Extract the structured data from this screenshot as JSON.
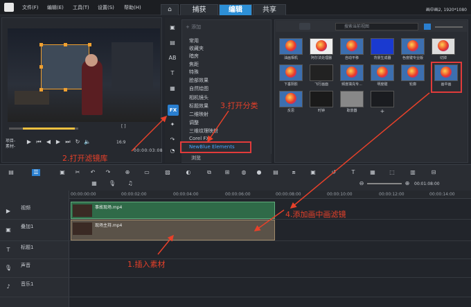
{
  "menus": [
    "文件(F)",
    "编辑(E)",
    "工具(T)",
    "设置(S)",
    "帮助(H)"
  ],
  "modes": [
    "捕获",
    "编辑",
    "共享"
  ],
  "project_info": "画中画2, 1920*1080",
  "preview": {
    "labels": [
      "项目-",
      "素材-"
    ],
    "timecode": "00:00:03:08",
    "zoom": "16:9"
  },
  "category_panel": {
    "add_label": "添加",
    "categories": [
      "常用",
      "收藏夹",
      "暗房",
      "焦距",
      "特殊",
      "脸部效果",
      "自然绘图",
      "相机镜头",
      "标题效果",
      "二维映射",
      "调整",
      "三维纹理映射",
      "Corel FX",
      "NewBlue Elements"
    ],
    "browse_label": "浏览"
  },
  "library": {
    "search_placeholder": "搜索当前视图",
    "effects": [
      "油画相机",
      "阿尔法处理器",
      "自动平移",
      "背景生成器",
      "色度键专业版",
      "切掉",
      "下垂阴影",
      "飞行画面",
      "频度填充专...",
      "明度键",
      "轮廓",
      "画中画",
      "反思",
      "时钟",
      "取景器"
    ]
  },
  "timeline": {
    "ruler": [
      "00:00:00:00",
      "00:00:02:00",
      "00:00:04:00",
      "00:00:06:00",
      "00:00:08:00",
      "00:00:10:00",
      "00:00:12:00",
      "00:00:14:00"
    ],
    "timecode": "00:01:08:00",
    "tracks": [
      "视频",
      "叠加1",
      "标题1",
      "声音",
      "音乐1"
    ],
    "clips": [
      {
        "track": "视频",
        "label": "事故现场.mp4"
      },
      {
        "track": "叠加1",
        "label": "现场主持.mp4"
      }
    ]
  },
  "annotations": [
    "1.插入素材",
    "2.打开滤镜库",
    "3.打开分类",
    "4.添加画中画滤镜"
  ],
  "colors": {
    "accent": "#2d8fd6",
    "annotation": "#e8412a",
    "video_clip": "#2f6a48",
    "overlay_clip": "#5a5248"
  }
}
